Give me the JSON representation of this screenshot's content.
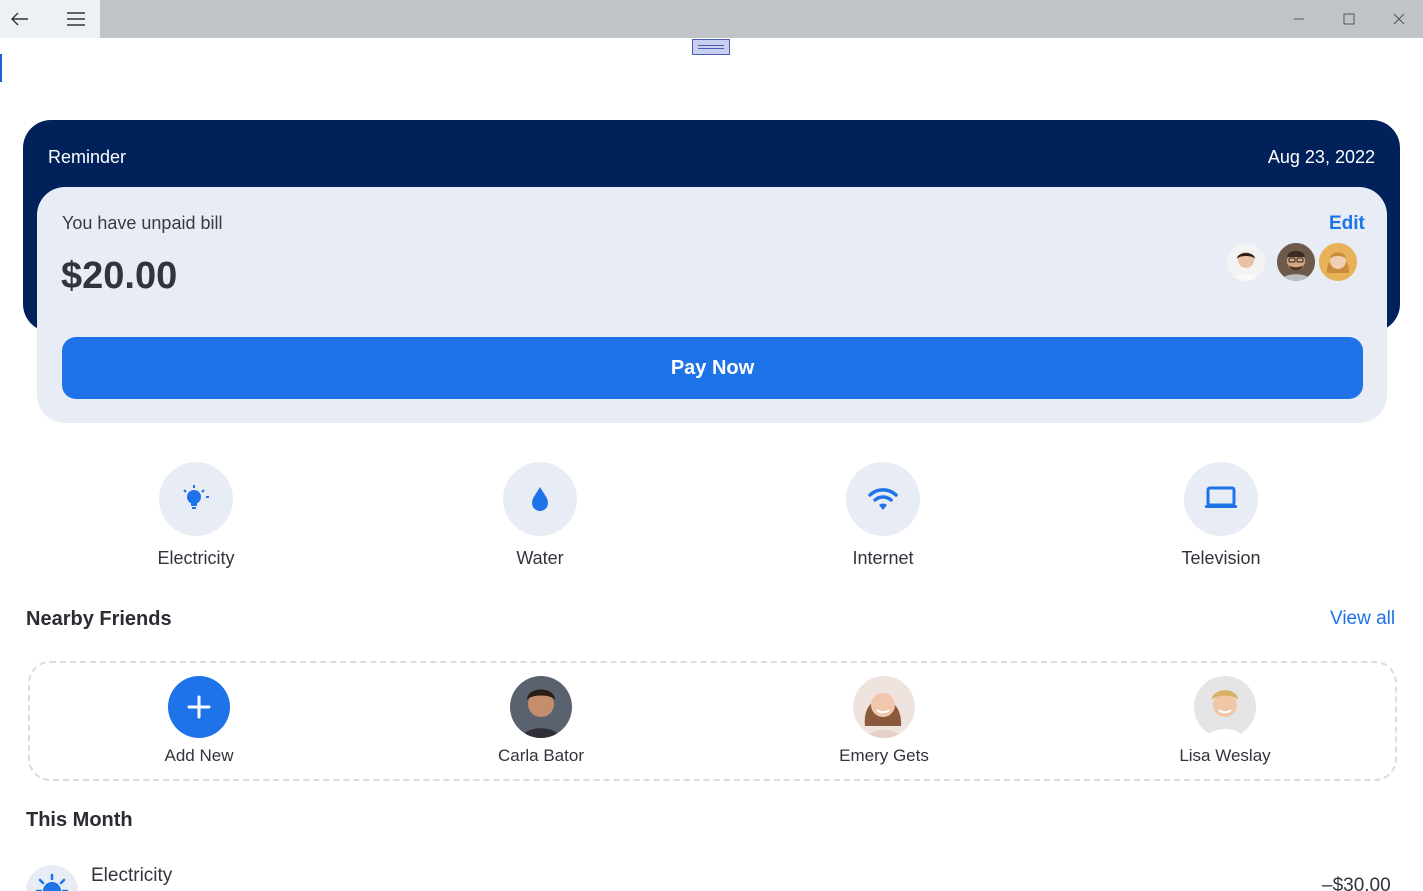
{
  "window": {
    "back_icon": "arrow-left-icon",
    "menu_icon": "hamburger-icon",
    "controls": [
      "minimize-icon",
      "maximize-icon",
      "close-icon"
    ]
  },
  "reminder": {
    "title": "Reminder",
    "date": "Aug 23, 2022",
    "message": "You have unpaid bill",
    "amount": "$20.00",
    "edit_label": "Edit",
    "pay_label": "Pay Now"
  },
  "categories": [
    {
      "label": "Electricity",
      "icon": "lightbulb-icon"
    },
    {
      "label": "Water",
      "icon": "water-drop-icon"
    },
    {
      "label": "Internet",
      "icon": "wifi-icon"
    },
    {
      "label": "Television",
      "icon": "monitor-icon"
    }
  ],
  "nearby_friends": {
    "title": "Nearby Friends",
    "view_all": "View all",
    "items": [
      {
        "label": "Add New",
        "icon": "plus-icon"
      },
      {
        "label": "Carla Bator"
      },
      {
        "label": "Emery Gets"
      },
      {
        "label": "Lisa Weslay"
      }
    ]
  },
  "this_month": {
    "title": "This Month",
    "transactions": [
      {
        "name": "Electricity",
        "amount": "–$30.00",
        "icon": "sun-icon"
      }
    ]
  },
  "colors": {
    "primary": "#1e73e8",
    "navy": "#00215a",
    "card_bg": "#e8ecf5"
  }
}
